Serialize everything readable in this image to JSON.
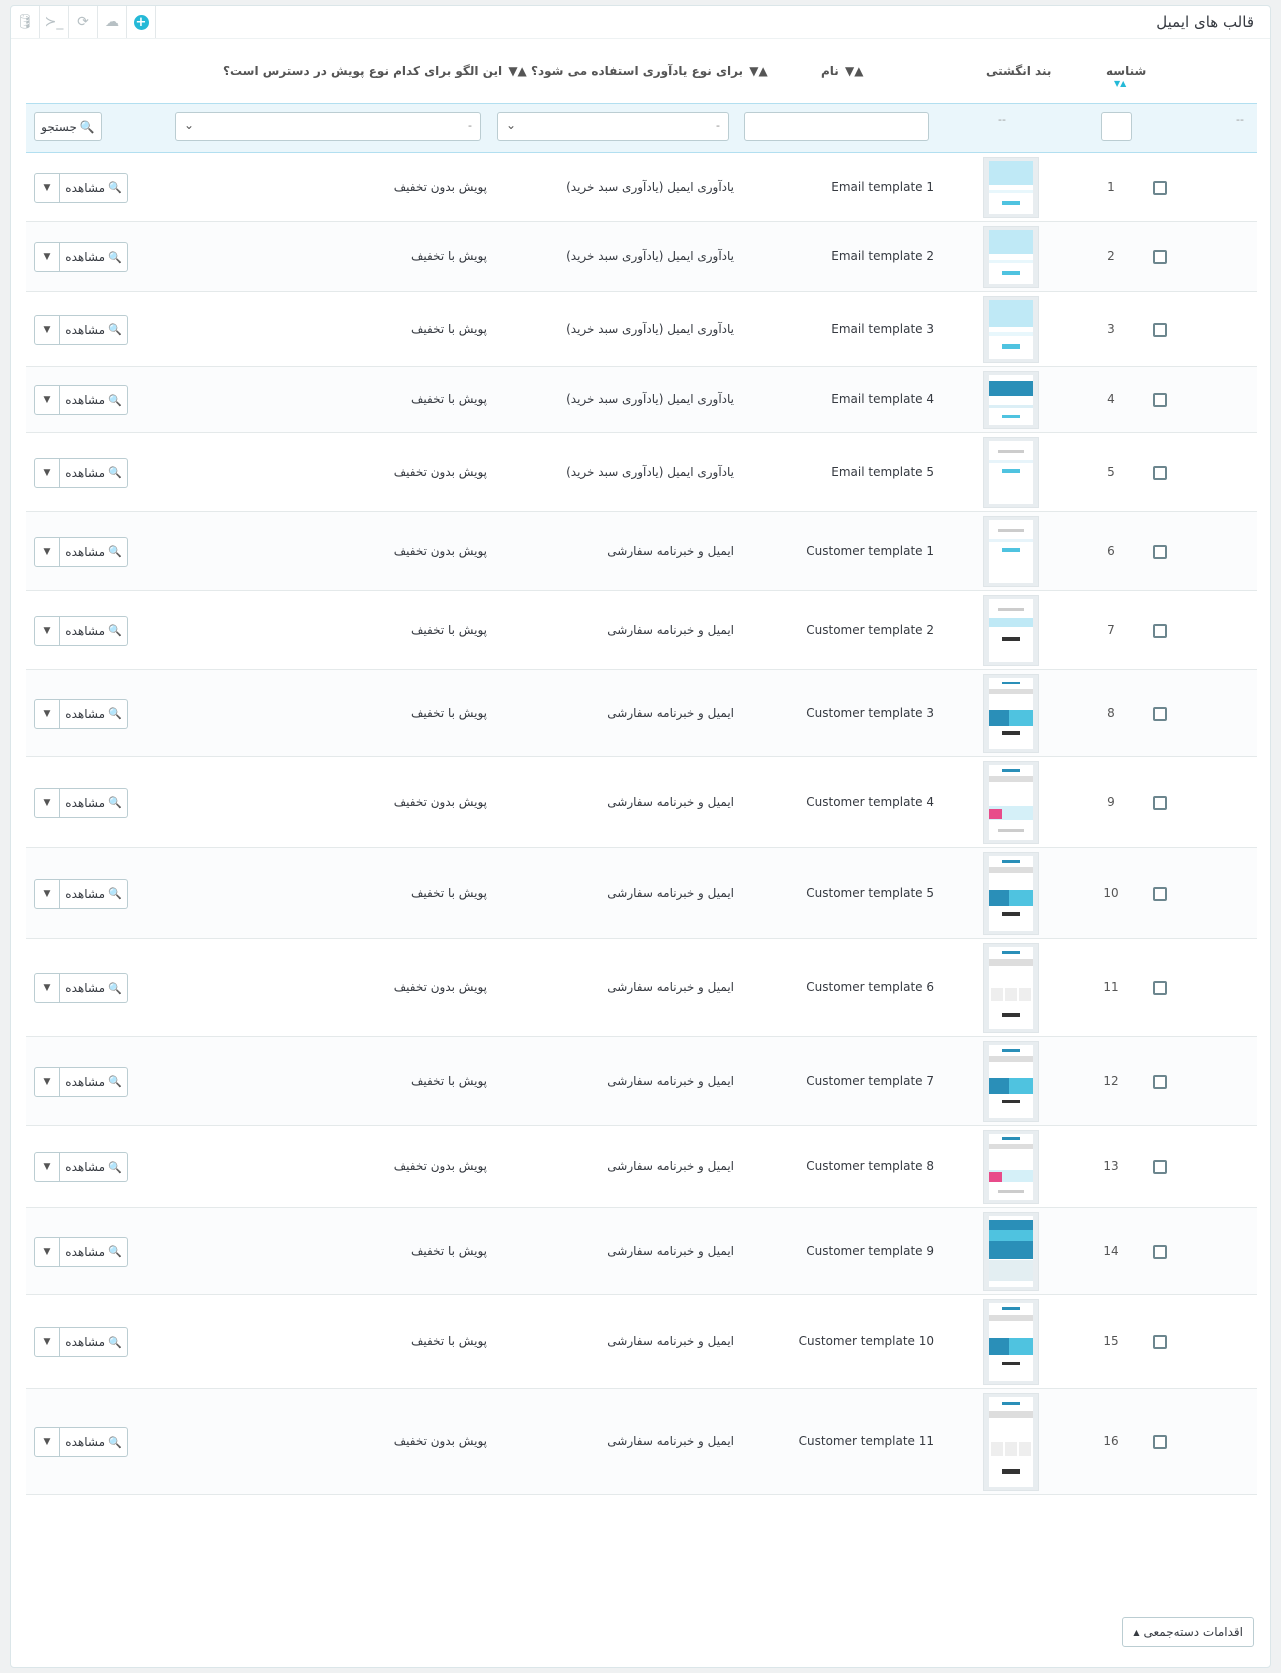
{
  "panel": {
    "title": "قالب های ایمیل",
    "toolbar": [
      {
        "name": "database-icon",
        "glyph": "🛢"
      },
      {
        "name": "terminal-icon",
        "glyph": "≻_"
      },
      {
        "name": "refresh-icon",
        "glyph": "⟳"
      },
      {
        "name": "cloud-upload-icon",
        "glyph": "☁"
      },
      {
        "name": "add-new-icon",
        "glyph": "+"
      }
    ]
  },
  "columns": {
    "id": "شناسه",
    "thumbnail": "بند انگشتی",
    "name": "نام",
    "usage_type": "برای نوع یادآوری استفاده می شود؟",
    "discount_type": "این الگو برای کدام نوع پویش در دسترس است؟"
  },
  "filters": {
    "dash": "--",
    "select_placeholder": "-",
    "search_label": "جستجو"
  },
  "rows": [
    {
      "id": "1",
      "name": "Email template 1",
      "type": "یادآوری ایمیل (یادآوری سبد خرید)",
      "discount": "پویش بدون تخفیف"
    },
    {
      "id": "2",
      "name": "Email template 2",
      "type": "یادآوری ایمیل (یادآوری سبد خرید)",
      "discount": "پویش با تخفیف"
    },
    {
      "id": "3",
      "name": "Email template 3",
      "type": "یادآوری ایمیل (یادآوری سبد خرید)",
      "discount": "پویش با تخفیف"
    },
    {
      "id": "4",
      "name": "Email template 4",
      "type": "یادآوری ایمیل (یادآوری سبد خرید)",
      "discount": "پویش با تخفیف"
    },
    {
      "id": "5",
      "name": "Email template 5",
      "type": "یادآوری ایمیل (یادآوری سبد خرید)",
      "discount": "پویش بدون تخفیف"
    },
    {
      "id": "6",
      "name": "Customer template 1",
      "type": "ایمیل و خبرنامه سفارشی",
      "discount": "پویش بدون تخفیف"
    },
    {
      "id": "7",
      "name": "Customer template 2",
      "type": "ایمیل و خبرنامه سفارشی",
      "discount": "پویش با تخفیف"
    },
    {
      "id": "8",
      "name": "Customer template 3",
      "type": "ایمیل و خبرنامه سفارشی",
      "discount": "پویش با تخفیف"
    },
    {
      "id": "9",
      "name": "Customer template 4",
      "type": "ایمیل و خبرنامه سفارشی",
      "discount": "پویش بدون تخفیف"
    },
    {
      "id": "10",
      "name": "Customer template 5",
      "type": "ایمیل و خبرنامه سفارشی",
      "discount": "پویش با تخفیف"
    },
    {
      "id": "11",
      "name": "Customer template 6",
      "type": "ایمیل و خبرنامه سفارشی",
      "discount": "پویش بدون تخفیف"
    },
    {
      "id": "12",
      "name": "Customer template 7",
      "type": "ایمیل و خبرنامه سفارشی",
      "discount": "پویش با تخفیف"
    },
    {
      "id": "13",
      "name": "Customer template 8",
      "type": "ایمیل و خبرنامه سفارشی",
      "discount": "پویش بدون تخفیف"
    },
    {
      "id": "14",
      "name": "Customer template 9",
      "type": "ایمیل و خبرنامه سفارشی",
      "discount": "پویش با تخفیف"
    },
    {
      "id": "15",
      "name": "Customer template 10",
      "type": "ایمیل و خبرنامه سفارشی",
      "discount": "پویش با تخفیف"
    },
    {
      "id": "16",
      "name": "Customer template 11",
      "type": "ایمیل و خبرنامه سفارشی",
      "discount": "پویش بدون تخفیف"
    }
  ],
  "row_actions": {
    "view_label": "مشاهده"
  },
  "bulk": {
    "label": "اقدامات دسته‌جمعی"
  },
  "colors": {
    "accent": "#25b9d7",
    "thumb_blue": "#4fc3e0",
    "thumb_dark_blue": "#2a8fb8"
  }
}
